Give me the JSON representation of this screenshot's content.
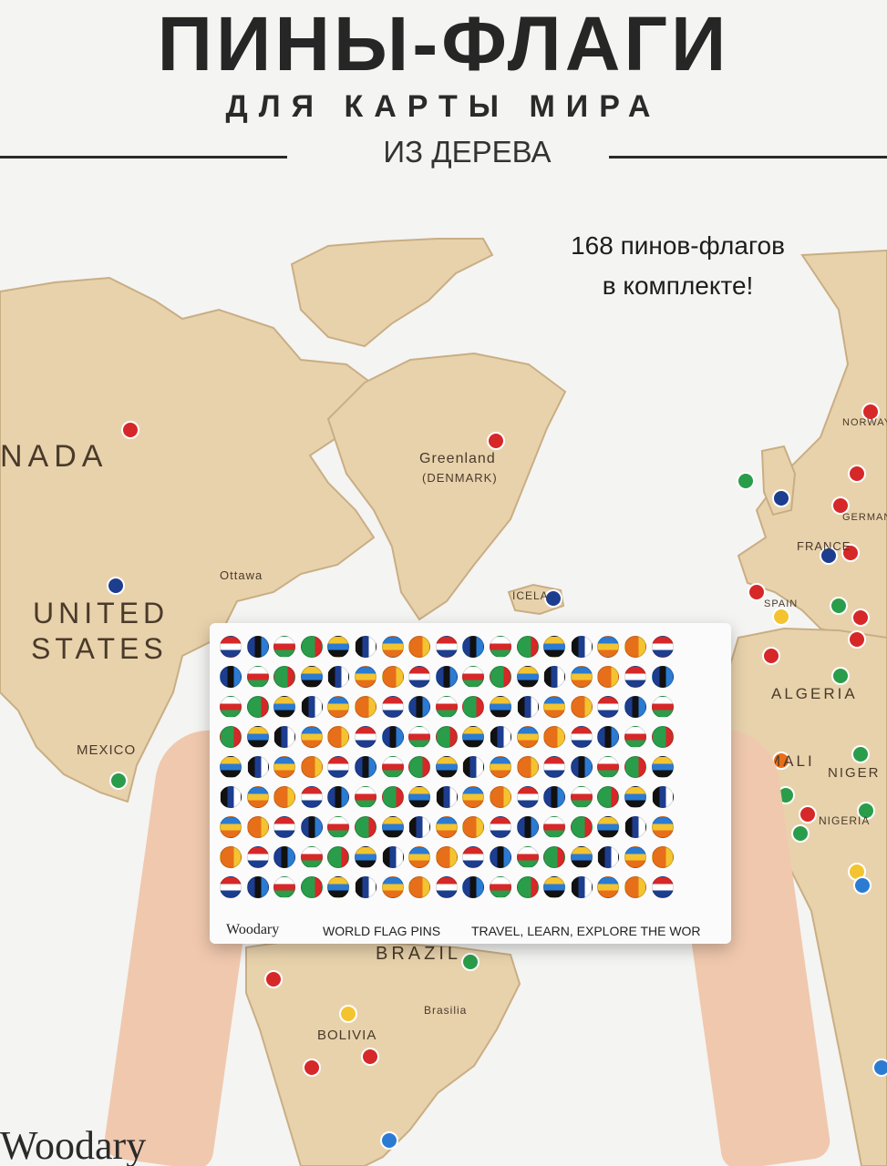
{
  "header": {
    "title": "ПИНЫ-ФЛАГИ",
    "subtitle": "ДЛЯ КАРТЫ МИРА",
    "material": "ИЗ ДЕРЕВА"
  },
  "callout": {
    "line1": "168 пинов-флагов",
    "line2": "в комплекте!"
  },
  "map_labels": {
    "canada": "NADA",
    "greenland": "Greenland",
    "denmark": "(DENMARK)",
    "united": "UNITED",
    "states": "STATES",
    "mexico": "MEXICO",
    "ottawa": "Ottawa",
    "brazil": "BRAZIL",
    "bolivia": "BOLIVIA",
    "brasilia": "Brasilia",
    "algeria": "ALGERIA",
    "mali": "MALI",
    "niger": "NIGER",
    "nigeria": "NIGERIA",
    "france": "FRANCE",
    "spain": "SPAIN",
    "norway": "NORWAY",
    "germany": "GERMANY",
    "iceland": "ICELA"
  },
  "board": {
    "brand": "Woodary",
    "name": "WORLD FLAG PINS",
    "slogan": "TRAVEL, LEARN, EXPLORE THE WOR"
  },
  "footer": {
    "brand": "Woodary"
  },
  "colors": {
    "wood": "#e8d2ac",
    "wood_edge": "#c9ae84",
    "background": "#f4f4f2",
    "skin": "#f0c8ae",
    "flag_palette": [
      "#d62828",
      "#1d3d8f",
      "#ffffff",
      "#2a9d4a",
      "#f4c430",
      "#111111",
      "#2b7bd3",
      "#e76f1a"
    ]
  }
}
